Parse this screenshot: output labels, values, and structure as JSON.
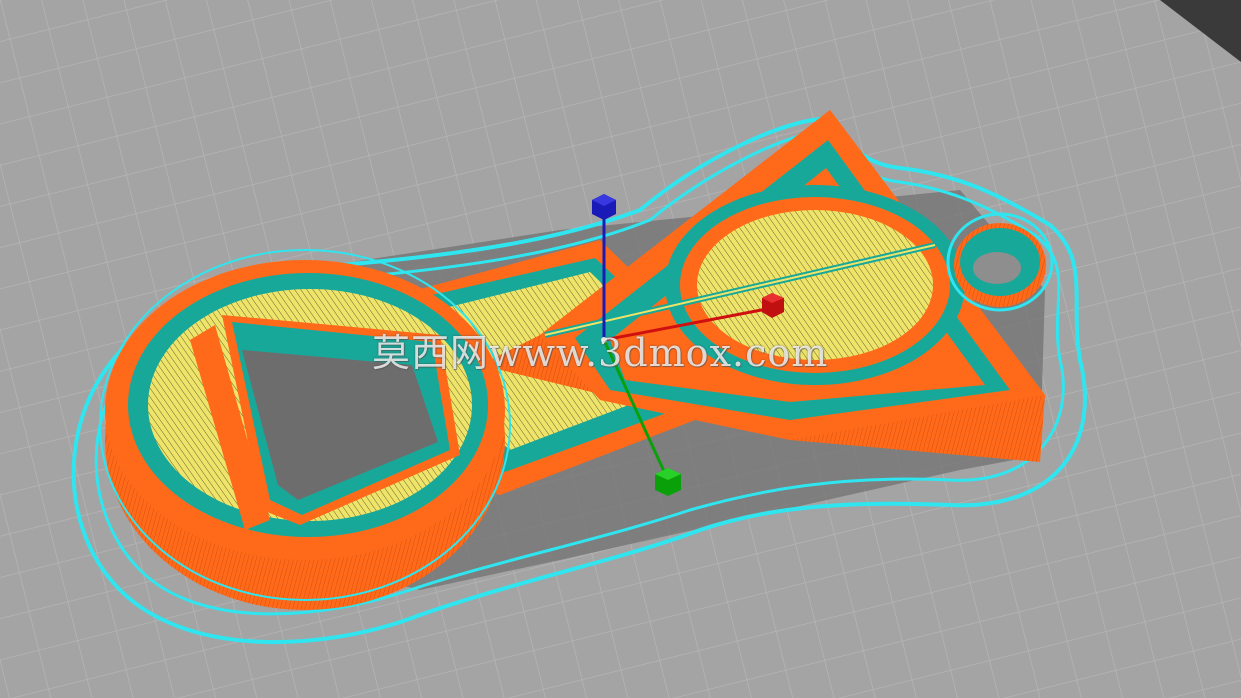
{
  "watermark": {
    "text": "莫西网www.3dmox.com"
  },
  "viewport": {
    "description_label": "3D slicer preview"
  },
  "colors": {
    "build_plate": "#a3a3a3",
    "grid_line": "#b6b6b6",
    "plate_edge": "#3c3c3c",
    "shadow": "#6e6e6e",
    "skirt": "#2fe6f0",
    "wall_outer": "#ff6a1a",
    "wall_inner": "#17a89a",
    "top_infill": "#efe46a",
    "gizmo_x": "#d01010",
    "gizmo_y": "#0aa00a",
    "gizmo_z": "#1a1ab8"
  },
  "icons": {
    "gizmo_x_handle": "red-cube-icon",
    "gizmo_y_handle": "green-cube-icon",
    "gizmo_z_handle": "blue-cube-icon"
  }
}
